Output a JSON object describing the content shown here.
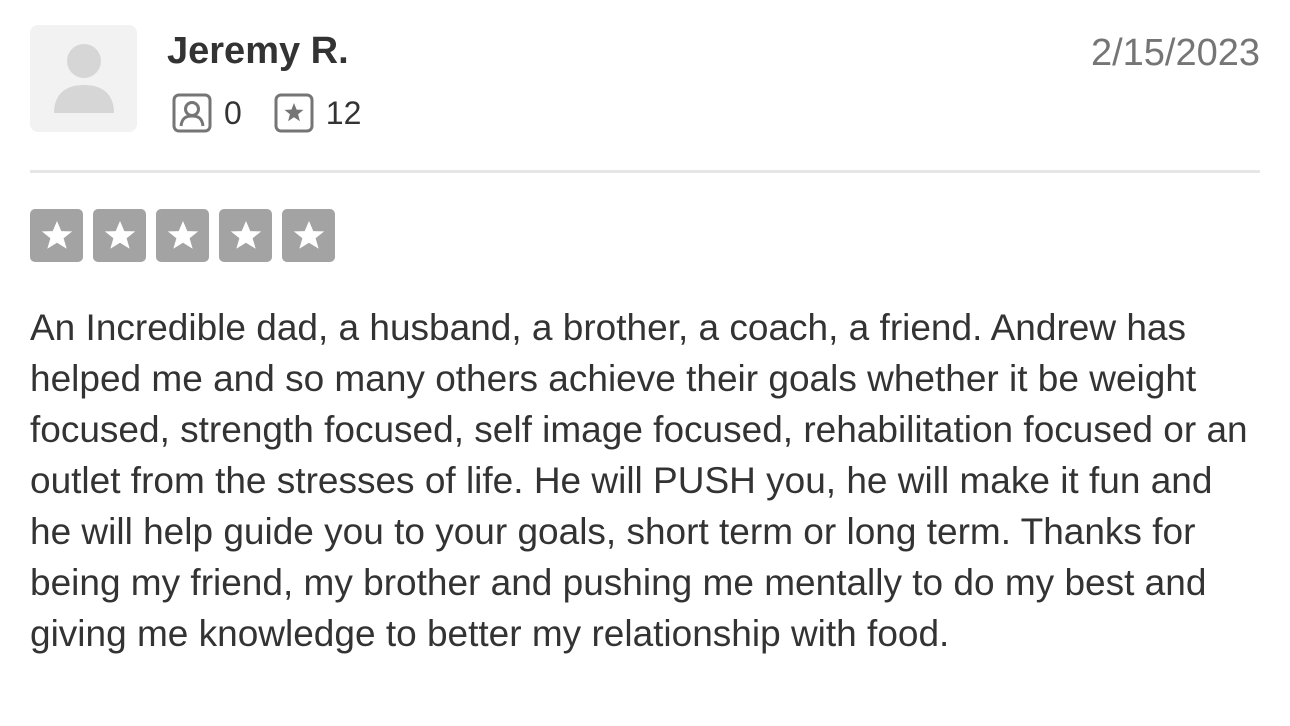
{
  "review": {
    "user": {
      "name": "Jeremy R.",
      "avatar_icon": "default-user-avatar-icon"
    },
    "stats": [
      {
        "icon": "friends-icon",
        "value": "0"
      },
      {
        "icon": "reviews-star-icon",
        "value": "12"
      }
    ],
    "date": "2/15/2023",
    "rating": {
      "value": 5,
      "max": 5,
      "color": "#a3a3a3",
      "star_icon": "star-icon"
    },
    "text": "An Incredible dad, a husband, a brother, a coach, a friend. Andrew has helped me and so many others achieve their goals whether it be weight focused, strength focused, self image focused, rehabilitation focused or an outlet from the stresses of life. He will PUSH you, he will make it fun and he will help guide you to your goals, short term or long term. Thanks for being my friend, my brother and pushing me mentally to do my best and giving me knowledge to better my relationship with food."
  }
}
